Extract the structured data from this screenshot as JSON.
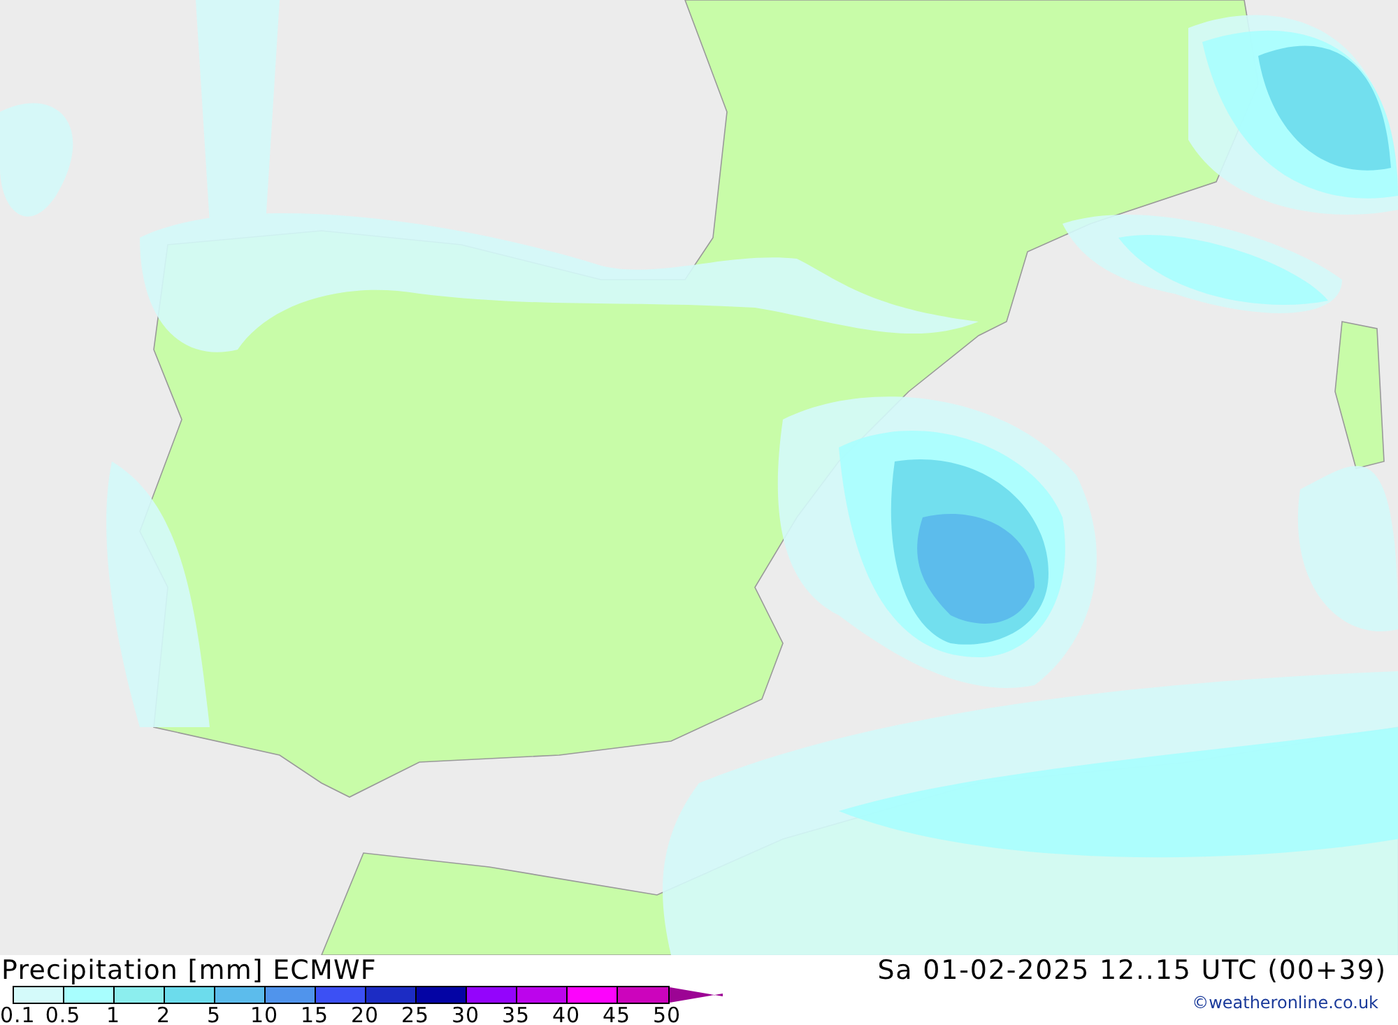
{
  "title": "Precipitation [mm] ECMWF",
  "valid_time": "Sa 01-02-2025 12..15 UTC (00+39)",
  "legend": {
    "swatches": [
      {
        "color": "#d4fafa"
      },
      {
        "color": "#a8fefe"
      },
      {
        "color": "#8ceeee"
      },
      {
        "color": "#6cdcec"
      },
      {
        "color": "#5cbcec"
      },
      {
        "color": "#5094ec"
      },
      {
        "color": "#3c50f4"
      },
      {
        "color": "#1c2cc4"
      },
      {
        "color": "#0404a4"
      },
      {
        "color": "#9404fc"
      },
      {
        "color": "#bc04ec"
      },
      {
        "color": "#fc04fc"
      },
      {
        "color": "#cc04bc"
      }
    ],
    "ticks": [
      "0.1",
      "0.5",
      "1",
      "2",
      "5",
      "10",
      "15",
      "20",
      "25",
      "30",
      "35",
      "40",
      "45",
      "50"
    ]
  },
  "credit": "©weatheronline.co.uk"
}
